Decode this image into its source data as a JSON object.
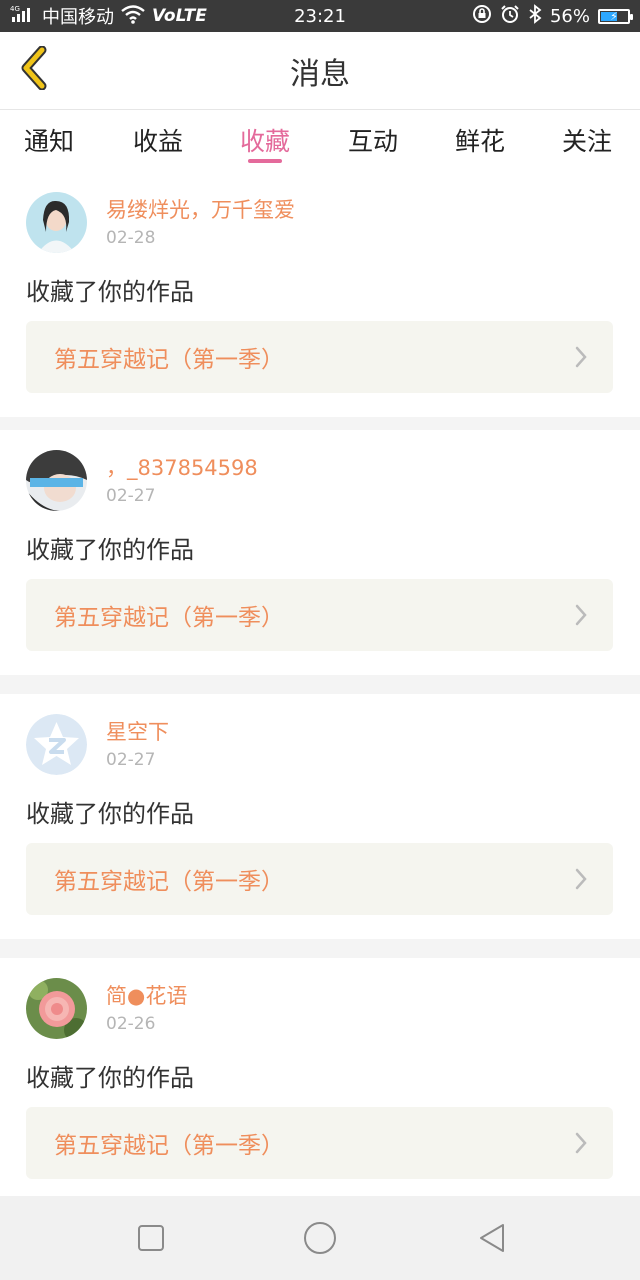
{
  "status_bar": {
    "signal_tag": "4G",
    "carrier": "中国移动",
    "volte": "VoLTE",
    "time": "23:21",
    "battery_percent": "56%",
    "battery_level": 0.56,
    "icons": [
      "signal-icon",
      "wifi-icon",
      "rotation-lock-icon",
      "alarm-icon",
      "bluetooth-icon",
      "battery-icon"
    ]
  },
  "header": {
    "title": "消息",
    "back_icon": "chevron-left-icon",
    "accent_back": "#f0c419"
  },
  "tabs": [
    {
      "label": "通知",
      "active": false
    },
    {
      "label": "收益",
      "active": false
    },
    {
      "label": "收藏",
      "active": true
    },
    {
      "label": "互动",
      "active": false
    },
    {
      "label": "鲜花",
      "active": false
    },
    {
      "label": "关注",
      "active": false
    }
  ],
  "colors": {
    "accent_pink": "#e46a9b",
    "name_orange": "#ef8e5c",
    "card_bg": "#f5f5ef"
  },
  "feed": [
    {
      "user": "易缕烊光，万千玺爱",
      "date": "02-28",
      "action": "收藏了你的作品",
      "work": "第五穿越记（第一季）"
    },
    {
      "user": "，_837854598",
      "date": "02-27",
      "action": "收藏了你的作品",
      "work": "第五穿越记（第一季）"
    },
    {
      "user": "星空下",
      "date": "02-27",
      "action": "收藏了你的作品",
      "work": "第五穿越记（第一季）"
    },
    {
      "user": "简●花语",
      "date": "02-26",
      "action": "收藏了你的作品",
      "work": "第五穿越记（第一季）"
    }
  ],
  "nav": {
    "icons": [
      "recent-apps-icon",
      "home-icon",
      "back-icon"
    ]
  }
}
